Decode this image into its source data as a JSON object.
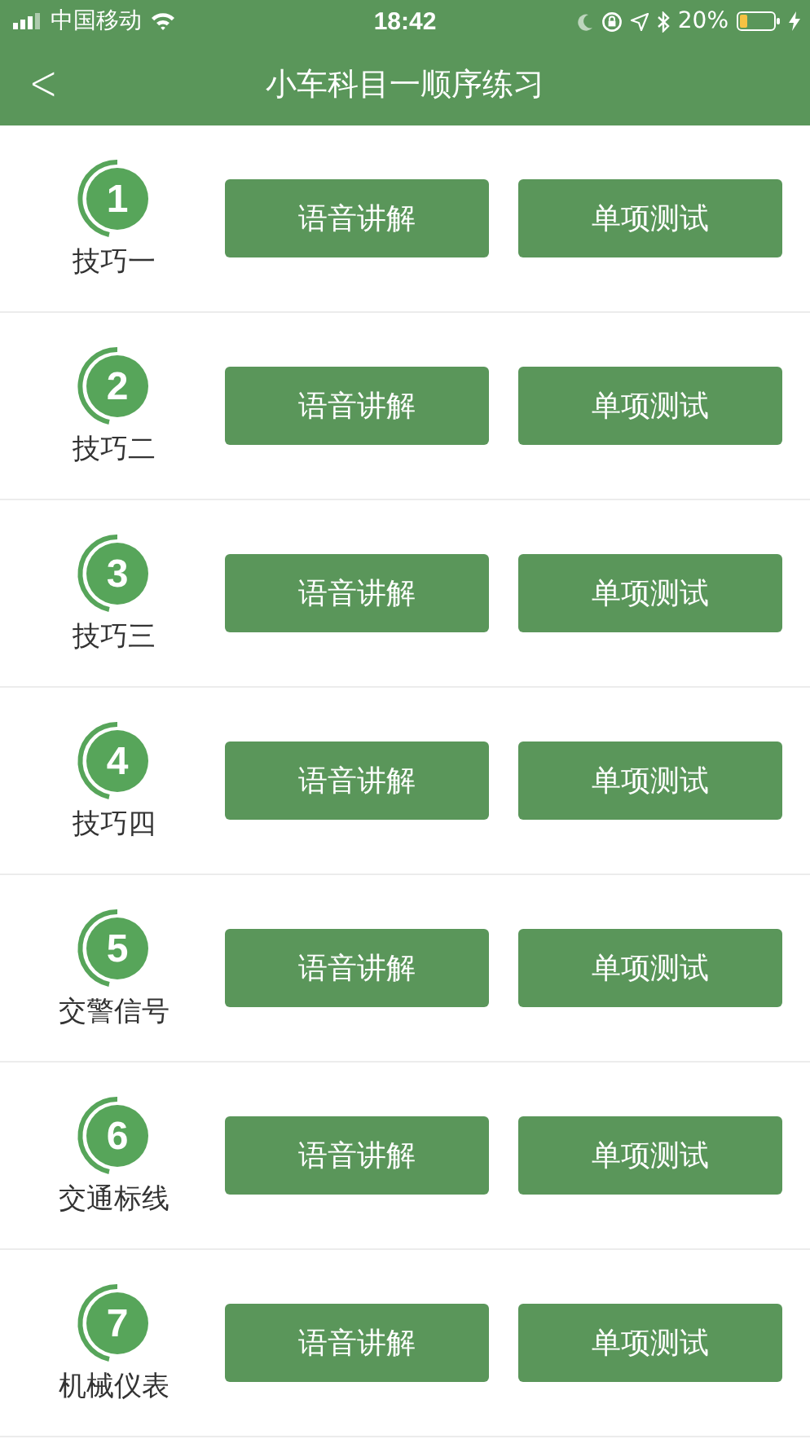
{
  "status_bar": {
    "carrier": "中国移动",
    "time": "18:42",
    "battery": "20%"
  },
  "nav": {
    "back": "<",
    "title": "小车科目一顺序练习"
  },
  "items": [
    {
      "number": "1",
      "name": "技巧一",
      "buttons": [
        "语音讲解",
        "单项测试"
      ]
    },
    {
      "number": "2",
      "name": "技巧二",
      "buttons": [
        "语音讲解",
        "单项测试"
      ]
    },
    {
      "number": "3",
      "name": "技巧三",
      "buttons": [
        "语音讲解",
        "单项测试"
      ]
    },
    {
      "number": "4",
      "name": "技巧四",
      "buttons": [
        "语音讲解",
        "单项测试"
      ]
    },
    {
      "number": "5",
      "name": "交警信号",
      "buttons": [
        "语音讲解",
        "单项测试"
      ]
    },
    {
      "number": "6",
      "name": "交通标线",
      "buttons": [
        "语音讲解",
        "单项测试"
      ]
    },
    {
      "number": "7",
      "name": "机械仪表",
      "buttons": [
        "语音讲解",
        "单项测试"
      ]
    }
  ]
}
